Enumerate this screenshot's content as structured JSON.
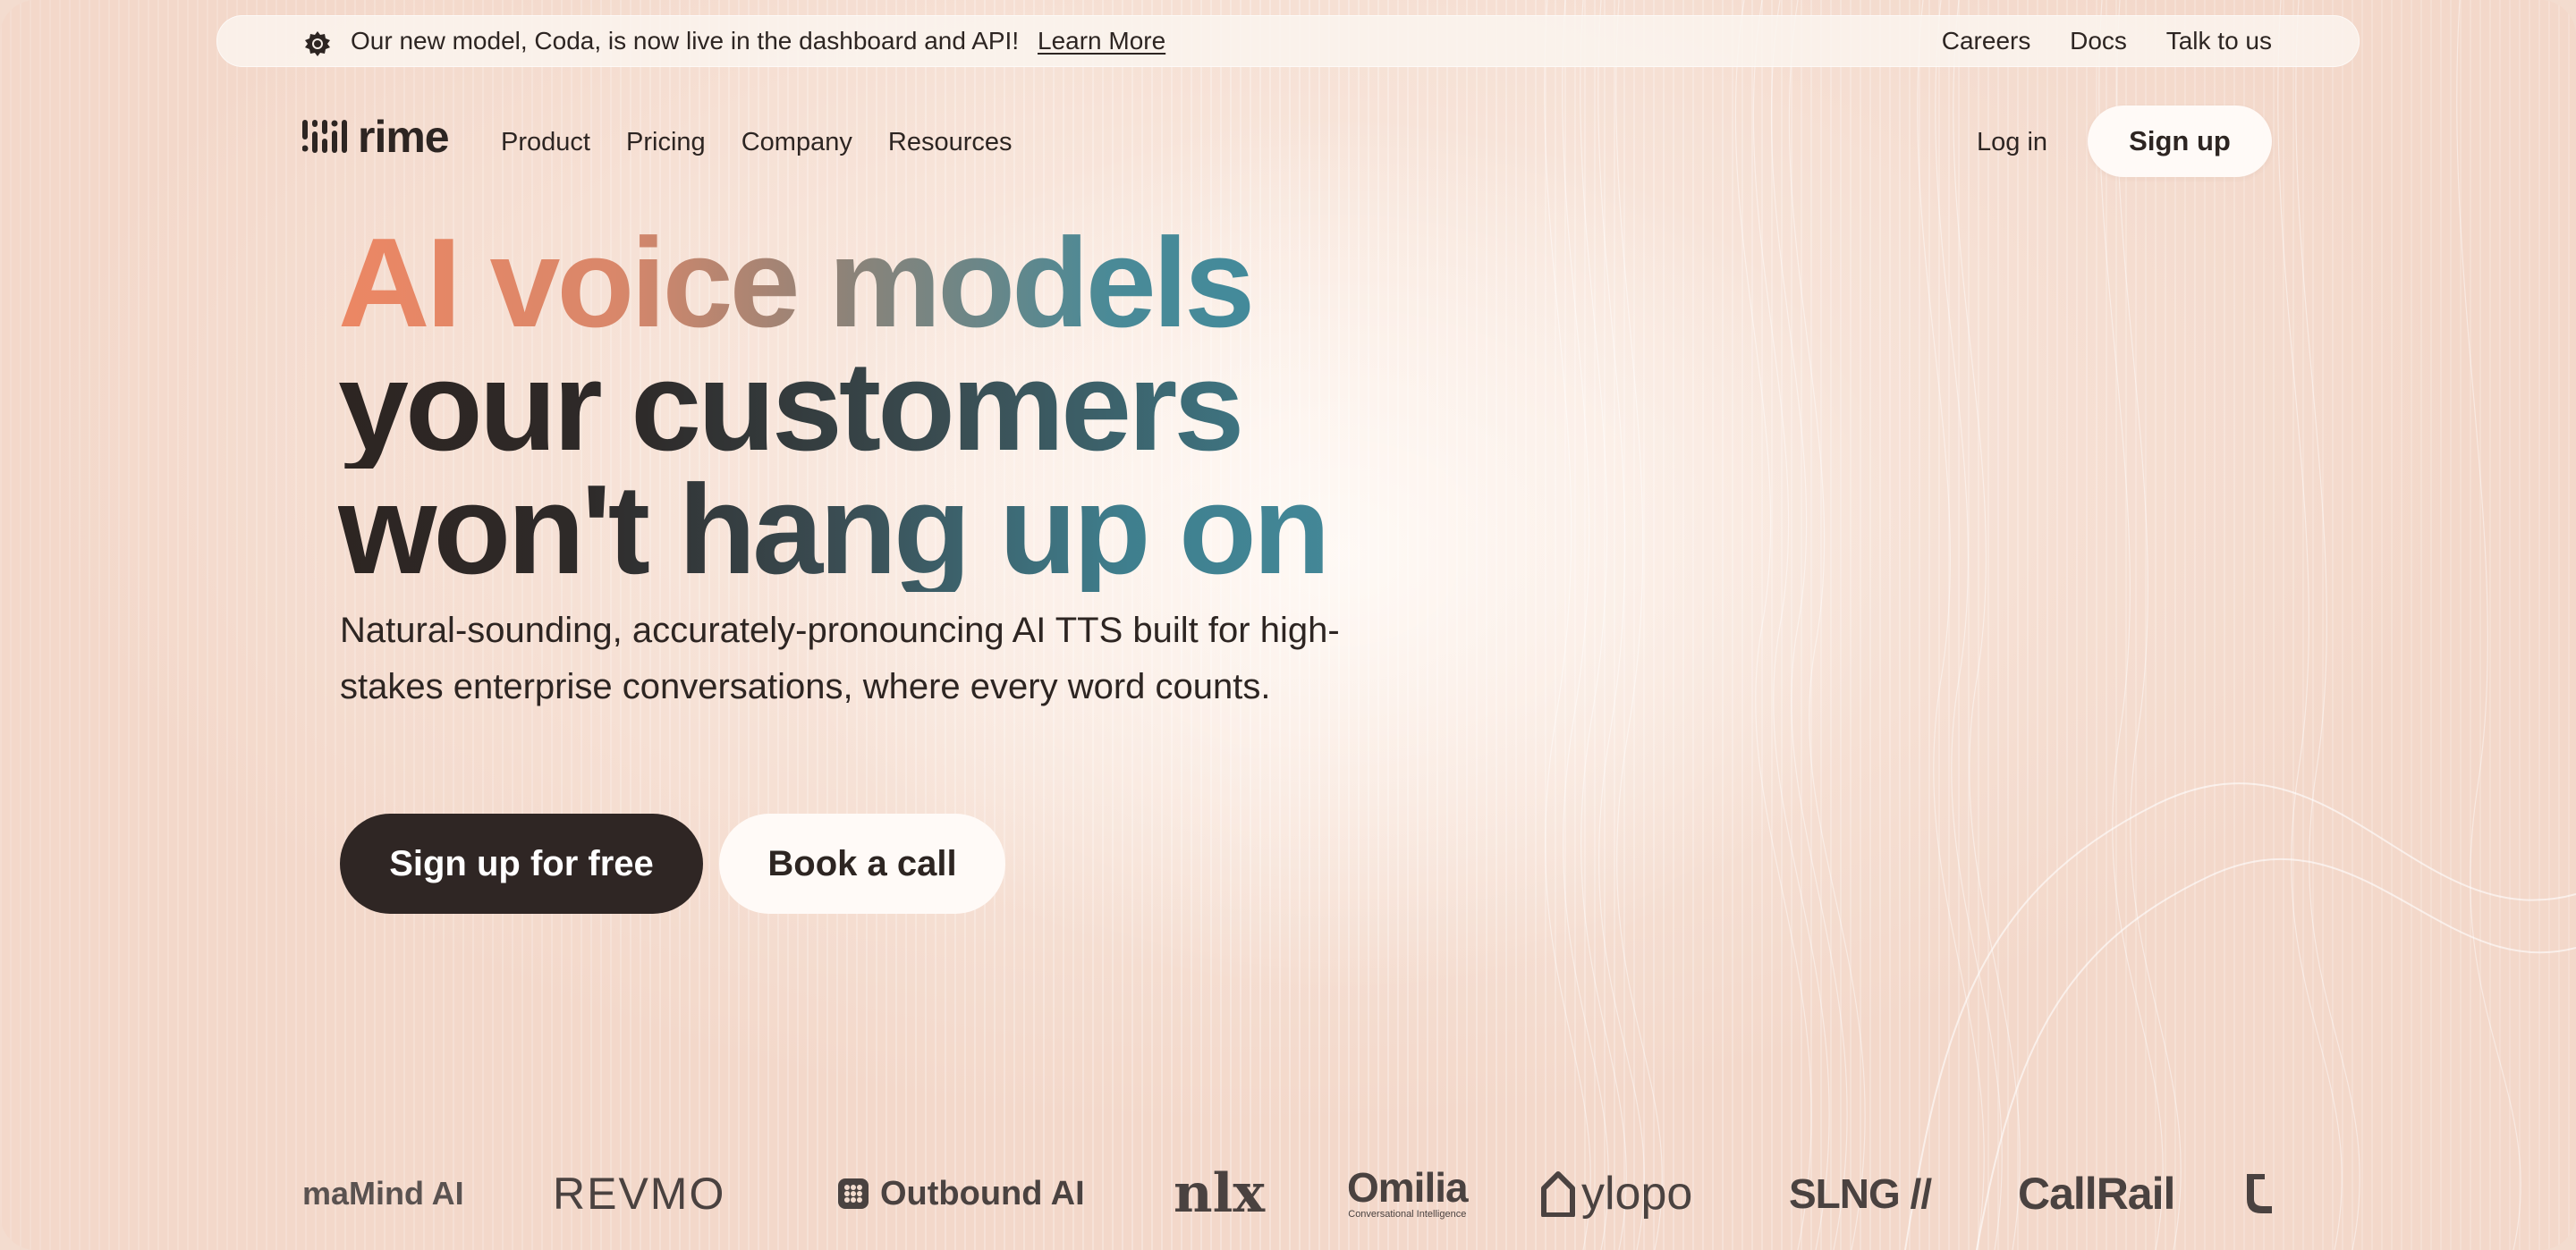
{
  "announcement": {
    "message": "Our new model, Coda, is now live in the dashboard and API!",
    "link": "Learn More",
    "links": [
      "Careers",
      "Docs",
      "Talk to us"
    ]
  },
  "nav": {
    "brand": "rime",
    "items": [
      "Product",
      "Pricing",
      "Company",
      "Resources"
    ],
    "login": "Log in",
    "signup": "Sign up"
  },
  "hero": {
    "line1": "AI voice models",
    "line2": "your customers",
    "line3": "won't hang up on",
    "subtitle": "Natural-sounding, accurately-pronouncing AI TTS built for high-stakes enterprise conversations, where every word counts.",
    "primary_cta": "Sign up for free",
    "secondary_cta": "Book a call"
  },
  "customer_logos": {
    "maMind": "maMind AI",
    "revmo": "REVMO",
    "outbound": "Outbound AI",
    "nlx": "nlx",
    "omilia": "Omilia",
    "omilia_tagline": "Conversational Intelligence",
    "ylopo": "ylopo",
    "slng": "SLNG //",
    "callrail": "CallRail"
  },
  "colors": {
    "background": "#f3dccf",
    "dark": "#2f2624",
    "accent_orange": "#ec8764",
    "accent_teal": "#3f8a9c"
  }
}
